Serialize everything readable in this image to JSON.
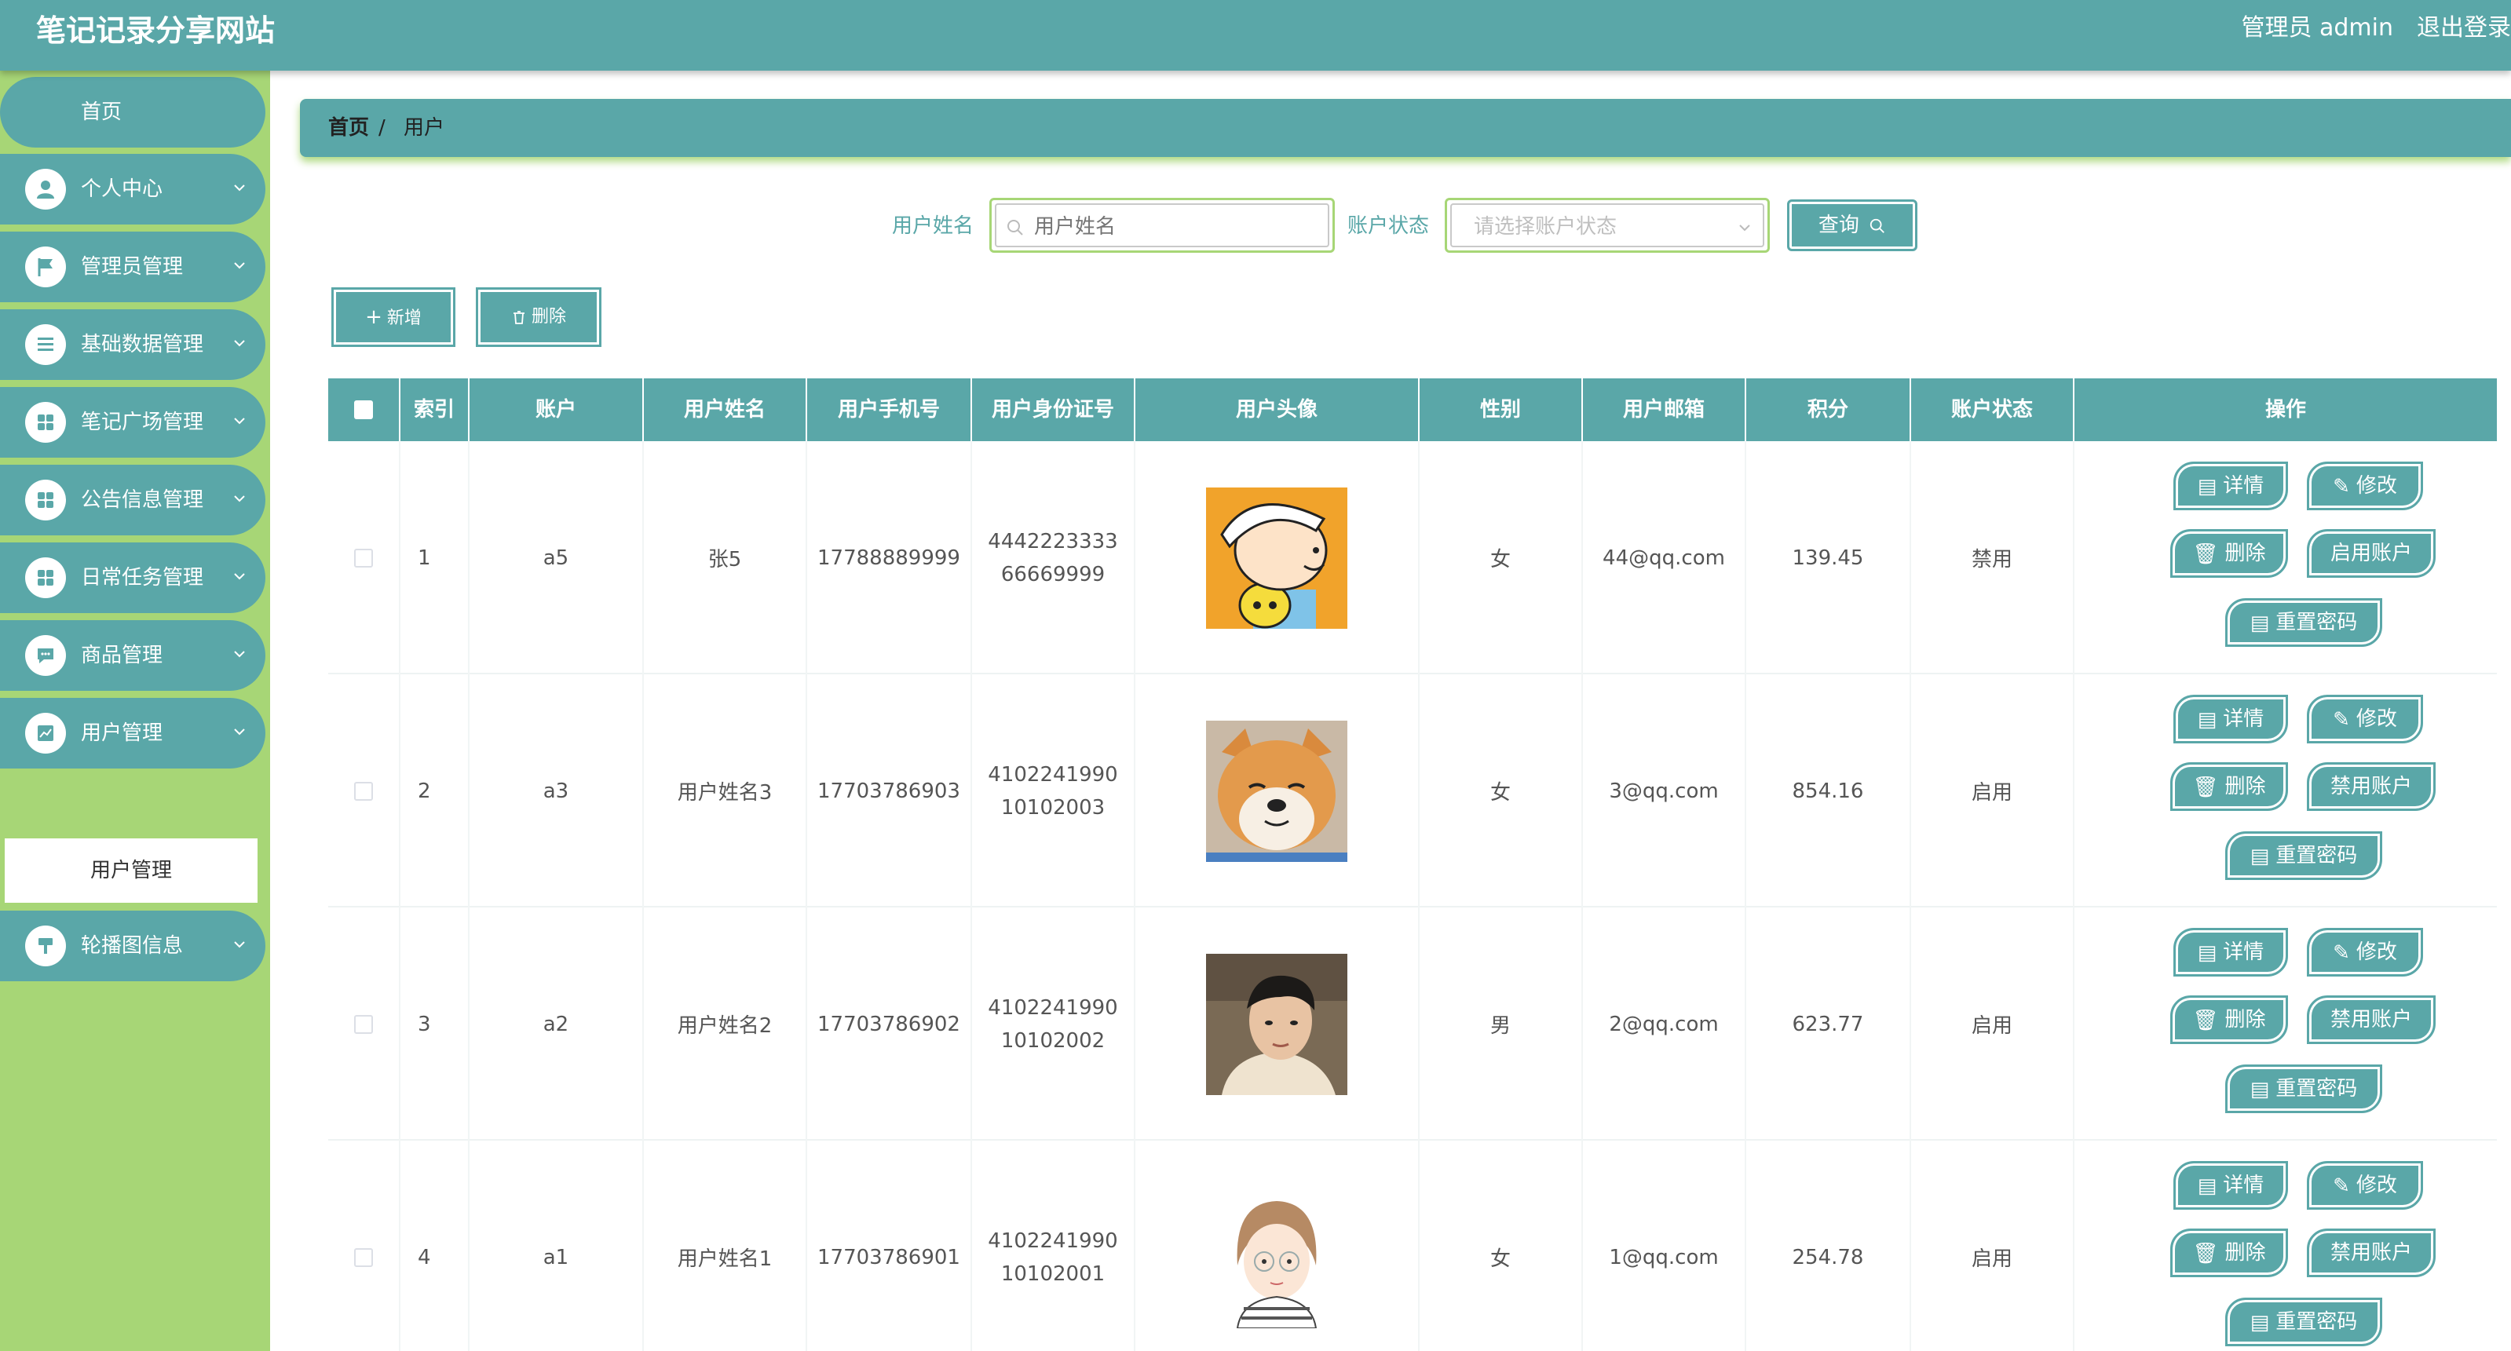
{
  "header": {
    "site_title": "笔记记录分享网站",
    "admin": "管理员 admin",
    "logout": "退出登录"
  },
  "sidebar": {
    "home": "首页",
    "items": [
      {
        "label": "个人中心",
        "icon": "user-icon"
      },
      {
        "label": "管理员管理",
        "icon": "flag-icon"
      },
      {
        "label": "基础数据管理",
        "icon": "list-icon"
      },
      {
        "label": "笔记广场管理",
        "icon": "grid-icon"
      },
      {
        "label": "公告信息管理",
        "icon": "grid-icon"
      },
      {
        "label": "日常任务管理",
        "icon": "grid-icon"
      },
      {
        "label": "商品管理",
        "icon": "chat-icon"
      },
      {
        "label": "用户管理",
        "icon": "chart-icon"
      },
      {
        "label": "轮播图信息",
        "icon": "pin-icon"
      }
    ],
    "submenu": "用户管理"
  },
  "breadcrumb": {
    "home": "首页",
    "sep": "/",
    "current": "用户"
  },
  "search": {
    "name_label": "用户姓名",
    "name_placeholder": "用户姓名",
    "status_label": "账户状态",
    "status_placeholder": "请选择账户状态",
    "query": "查询"
  },
  "actions": {
    "add": "新增",
    "delete": "删除"
  },
  "table": {
    "headers": [
      "索引",
      "账户",
      "用户姓名",
      "用户手机号",
      "用户身份证号",
      "用户头像",
      "性别",
      "用户邮箱",
      "积分",
      "账户状态",
      "操作"
    ],
    "rows": [
      {
        "index": "1",
        "account": "a5",
        "name": "张5",
        "phone": "17788889999",
        "id_card": "444222333366669999",
        "gender": "女",
        "email": "44@qq.com",
        "points": "139.45",
        "status": "禁用",
        "avatar": "cartoon-boy-avatar",
        "toggle": "启用账户"
      },
      {
        "index": "2",
        "account": "a3",
        "name": "用户姓名3",
        "phone": "17703786903",
        "id_card": "410224199010102003",
        "gender": "女",
        "email": "3@qq.com",
        "points": "854.16",
        "status": "启用",
        "avatar": "shiba-dog-avatar",
        "toggle": "禁用账户"
      },
      {
        "index": "3",
        "account": "a2",
        "name": "用户姓名2",
        "phone": "17703786902",
        "id_card": "410224199010102002",
        "gender": "男",
        "email": "2@qq.com",
        "points": "623.77",
        "status": "启用",
        "avatar": "young-man-avatar",
        "toggle": "禁用账户"
      },
      {
        "index": "4",
        "account": "a1",
        "name": "用户姓名1",
        "phone": "17703786901",
        "id_card": "410224199010102001",
        "gender": "女",
        "email": "1@qq.com",
        "points": "254.78",
        "status": "启用",
        "avatar": "cartoon-girl-avatar",
        "toggle": "禁用账户"
      }
    ],
    "ops": {
      "detail": "详情",
      "edit": "修改",
      "delete": "删除",
      "reset": "重置密码"
    }
  },
  "colors": {
    "primary": "#5aa7a8",
    "sidebar": "#a7d676",
    "white": "#ffffff"
  }
}
